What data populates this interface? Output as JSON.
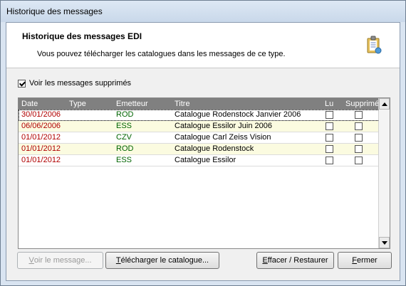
{
  "window": {
    "title": "Historique des messages"
  },
  "header": {
    "title": "Historique des messages EDI",
    "subtitle": "Vous pouvez télécharger les catalogues dans les messages de ce type.",
    "icon": "clipboard-icon"
  },
  "show_deleted": {
    "label": "Voir les messages supprimés",
    "checked": true
  },
  "grid": {
    "columns": [
      "Date",
      "Type",
      "Emetteur",
      "Titre",
      "Lu",
      "Supprimé"
    ],
    "rows": [
      {
        "date": "30/01/2006",
        "type": "",
        "emetteur": "ROD",
        "titre": "Catalogue Rodenstock Janvier 2006",
        "lu": false,
        "supprime": false,
        "bg": "#ffffff",
        "selected": true
      },
      {
        "date": "06/06/2006",
        "type": "",
        "emetteur": "ESS",
        "titre": "Catalogue Essilor Juin 2006",
        "lu": false,
        "supprime": false,
        "bg": "#fbfbe0",
        "selected": false
      },
      {
        "date": "01/01/2012",
        "type": "",
        "emetteur": "CZV",
        "titre": "Catalogue Carl Zeiss Vision",
        "lu": false,
        "supprime": false,
        "bg": "#ffffff",
        "selected": false
      },
      {
        "date": "01/01/2012",
        "type": "",
        "emetteur": "ROD",
        "titre": "Catalogue Rodenstock",
        "lu": false,
        "supprime": false,
        "bg": "#fbfbe0",
        "selected": false
      },
      {
        "date": "01/01/2012",
        "type": "",
        "emetteur": "ESS",
        "titre": "Catalogue Essilor",
        "lu": false,
        "supprime": false,
        "bg": "#ffffff",
        "selected": false
      }
    ],
    "date_color": "#b00000",
    "emetteur_color": "#006400"
  },
  "buttons": {
    "view_message": {
      "pre": "",
      "key": "V",
      "post": "oir le message...",
      "enabled": false
    },
    "download": {
      "pre": "",
      "key": "T",
      "post": "élécharger le catalogue...",
      "enabled": true
    },
    "delete_restore": {
      "pre": "",
      "key": "E",
      "post": "ffacer / Restaurer",
      "enabled": true
    },
    "close": {
      "pre": "",
      "key": "F",
      "post": "ermer",
      "enabled": true
    }
  }
}
